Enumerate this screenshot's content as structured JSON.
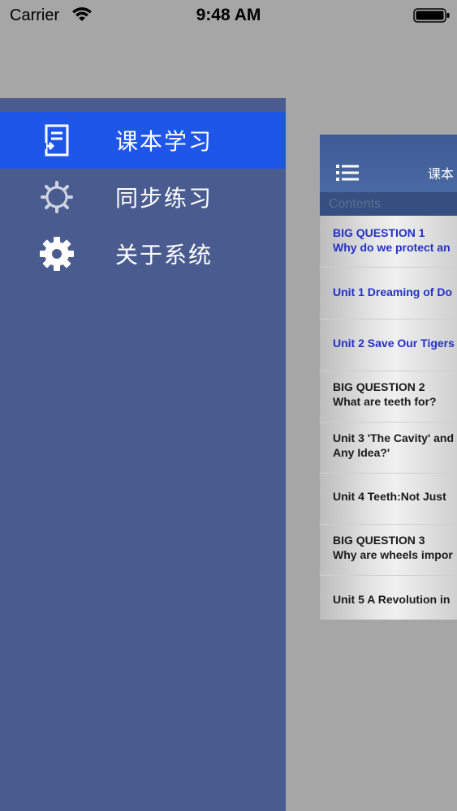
{
  "status_bar": {
    "carrier": "Carrier",
    "time": "9:48 AM"
  },
  "sidebar": {
    "items": [
      {
        "label": "课本学习",
        "icon": "textbook-icon",
        "active": true
      },
      {
        "label": "同步练习",
        "icon": "gear-outline-icon",
        "active": false
      },
      {
        "label": "关于系统",
        "icon": "gear-icon",
        "active": false
      }
    ]
  },
  "content": {
    "nav_title": "课本",
    "section_header": "Contents",
    "rows": [
      {
        "line1": "BIG QUESTION 1",
        "line2": "Why do we protect an",
        "style": "blue"
      },
      {
        "line1": "Unit 1 Dreaming of Do",
        "line2": "",
        "style": "blue"
      },
      {
        "line1": "Unit 2 Save Our Tigers",
        "line2": "",
        "style": "blue"
      },
      {
        "line1": "BIG QUESTION 2",
        "line2": "What are teeth for?",
        "style": "dark"
      },
      {
        "line1": "Unit 3 'The Cavity' and",
        "line2": "Any Idea?'",
        "style": "dark"
      },
      {
        "line1": "Unit 4 Teeth:Not Just",
        "line2": "",
        "style": "dark"
      },
      {
        "line1": "BIG QUESTION 3",
        "line2": "Why are wheels impor",
        "style": "dark"
      },
      {
        "line1": "Unit 5 A Revolution in",
        "line2": "",
        "style": "dark"
      }
    ]
  },
  "colors": {
    "sidebar_bg": "#4a5c8f",
    "active_item_bg": "#1f56ea",
    "link_blue": "#2230c8"
  }
}
